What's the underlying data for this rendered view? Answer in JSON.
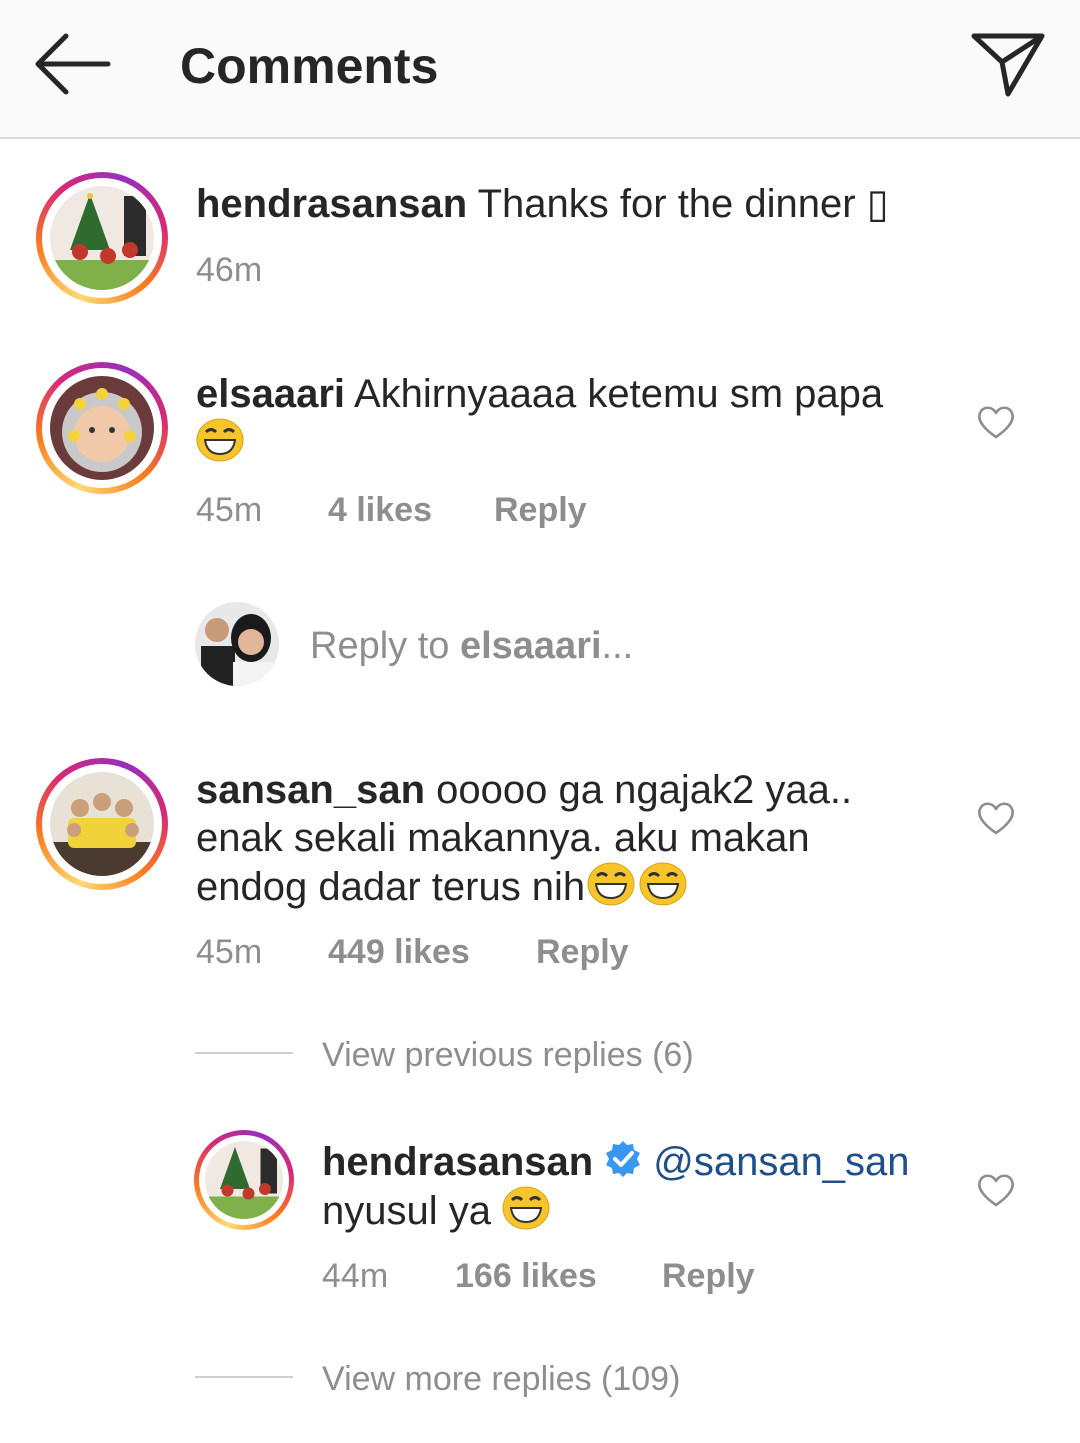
{
  "header": {
    "title": "Comments"
  },
  "caption": {
    "username": "hendrasansan",
    "text": "Thanks for the dinner ▯",
    "time": "46m"
  },
  "comments": [
    {
      "username": "elsaaari",
      "text": "Akhirnyaaaa ketemu sm papa",
      "time": "45m",
      "likes": "4 likes",
      "reply": "Reply"
    },
    {
      "username": "sansan_san",
      "line1": "ooooo ga ngajak2 yaa..",
      "line2": "enak sekali makannya. aku makan",
      "line3": "endog dadar terus nih",
      "time": "45m",
      "likes": "449 likes",
      "reply": "Reply"
    }
  ],
  "reply_box": {
    "prefix": "Reply to ",
    "username": "elsaaari",
    "suffix": "..."
  },
  "view_previous": "View previous replies (6)",
  "nested_reply": {
    "username": "hendrasansan",
    "mention": "@sansan_san",
    "text": "nyusul ya",
    "time": "44m",
    "likes": "166 likes",
    "reply": "Reply"
  },
  "view_more": "View more replies (109)",
  "colors": {
    "accent_mention": "#1e4f8a",
    "verified": "#3897f0",
    "meta_text": "#8e8e8e"
  },
  "icons": {
    "back": "arrow-left-icon",
    "send": "paper-plane-icon",
    "like": "heart-icon",
    "verified": "verified-badge-icon",
    "emoji": "grinning-face-emoji"
  }
}
